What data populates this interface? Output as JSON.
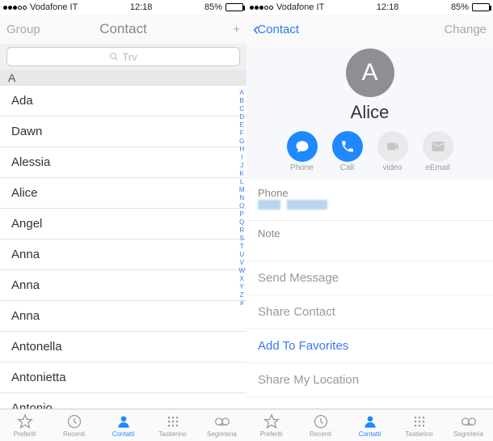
{
  "status": {
    "carrier": "Vodafone IT",
    "time": "12:18",
    "battery": "85%"
  },
  "left": {
    "nav": {
      "left": "Group",
      "title": "Contact",
      "right": "+"
    },
    "search": {
      "placeholder": "Trv"
    },
    "section": "A",
    "index": [
      "A",
      "B",
      "C",
      "D",
      "E",
      "F",
      "G",
      "H",
      "I",
      "J",
      "K",
      "L",
      "M",
      "N",
      "O",
      "P",
      "Q",
      "R",
      "S",
      "T",
      "U",
      "V",
      "W",
      "X",
      "Y",
      "Z",
      "#"
    ],
    "contacts": [
      "Ada",
      "Dawn",
      "Alessia",
      "Alice",
      "Angel",
      "Anna",
      "Anna",
      "Anna",
      "Antonella",
      "Antonietta",
      "Antonio"
    ]
  },
  "right": {
    "nav": {
      "back": "Contact",
      "right": "Change"
    },
    "avatar": "A",
    "name": "Alice",
    "buttons": [
      {
        "key": "message",
        "label": "Phone",
        "active": true
      },
      {
        "key": "call",
        "label": "Call",
        "active": true
      },
      {
        "key": "video",
        "label": "video",
        "active": false
      },
      {
        "key": "email",
        "label": "eEmail",
        "active": false
      }
    ],
    "phone_label": "Phone",
    "note_label": "Note",
    "links": [
      "Send Message",
      "Share Contact",
      "Add To Favorites",
      "Share My Location"
    ]
  },
  "tabs": [
    {
      "key": "fav",
      "label": "Preferiti"
    },
    {
      "key": "rec",
      "label": "Recenti"
    },
    {
      "key": "con",
      "label": "Contatti"
    },
    {
      "key": "key",
      "label": "Tastierino"
    },
    {
      "key": "vm",
      "label": "Segreteria"
    }
  ]
}
